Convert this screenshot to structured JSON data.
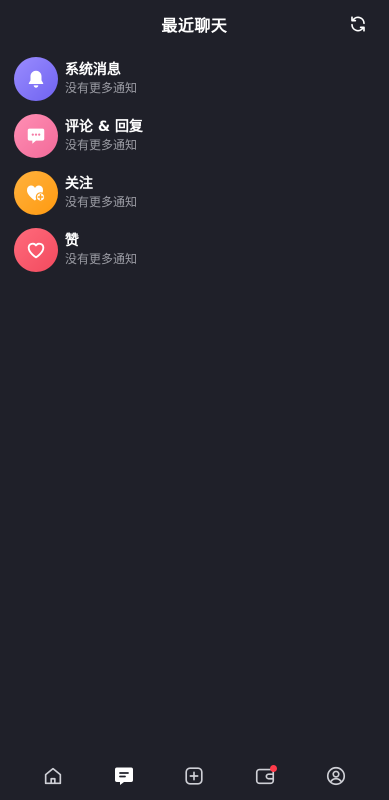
{
  "header": {
    "title": "最近聊天",
    "refresh_icon": "refresh-icon"
  },
  "items": [
    {
      "title": "系统消息",
      "subtitle": "没有更多通知",
      "icon": "bell-icon",
      "color": "#7f74f8"
    },
    {
      "title": "评论 & 回复",
      "subtitle": "没有更多通知",
      "icon": "comment-icon",
      "color": "#f57aa5"
    },
    {
      "title": "关注",
      "subtitle": "没有更多通知",
      "icon": "follow-heart-icon",
      "color": "#ffa526"
    },
    {
      "title": "赞",
      "subtitle": "没有更多通知",
      "icon": "heart-icon",
      "color": "#f55a6c"
    }
  ],
  "bottom_nav": {
    "items": [
      "home-icon",
      "message-icon",
      "add-icon",
      "wallet-icon",
      "profile-icon"
    ],
    "active": "message-icon",
    "badge_color": "#ff3b4a"
  }
}
